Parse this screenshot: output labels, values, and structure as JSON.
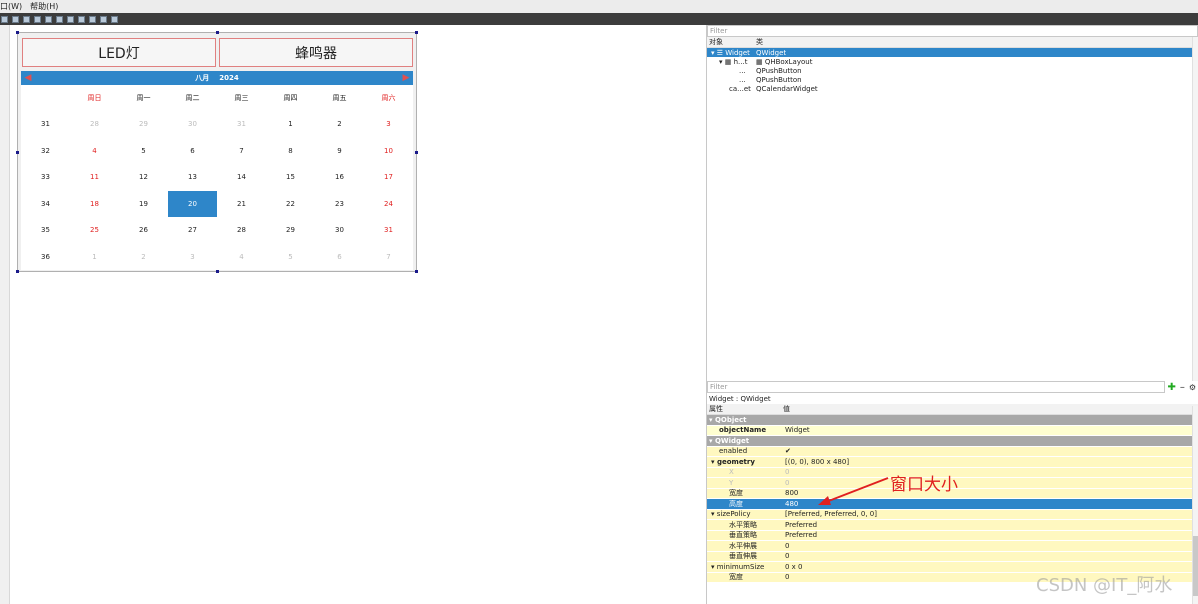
{
  "menu": {
    "items": [
      "口(W)",
      "帮助(H)"
    ]
  },
  "form": {
    "buttons": [
      "LED灯",
      "蜂鸣器"
    ],
    "calendar": {
      "month": "八月",
      "year": "2024",
      "weekday_headers": [
        "周日",
        "周一",
        "周二",
        "周三",
        "周四",
        "周五",
        "周六"
      ],
      "weeks": [
        {
          "num": "31",
          "days": [
            "28",
            "29",
            "30",
            "31",
            "1",
            "2",
            "3"
          ]
        },
        {
          "num": "32",
          "days": [
            "4",
            "5",
            "6",
            "7",
            "8",
            "9",
            "10"
          ]
        },
        {
          "num": "33",
          "days": [
            "11",
            "12",
            "13",
            "14",
            "15",
            "16",
            "17"
          ]
        },
        {
          "num": "34",
          "days": [
            "18",
            "19",
            "20",
            "21",
            "22",
            "23",
            "24"
          ]
        },
        {
          "num": "35",
          "days": [
            "25",
            "26",
            "27",
            "28",
            "29",
            "30",
            "31"
          ]
        },
        {
          "num": "36",
          "days": [
            "1",
            "2",
            "3",
            "4",
            "5",
            "6",
            "7"
          ]
        }
      ],
      "selected_day": "20"
    }
  },
  "object_inspector": {
    "filter_placeholder": "Filter",
    "col_object": "对象",
    "col_class": "类",
    "rows": [
      {
        "name": "Widget",
        "cls": "QWidget"
      },
      {
        "name": "h...t",
        "cls": "QHBoxLayout"
      },
      {
        "name": "...",
        "cls": "QPushButton"
      },
      {
        "name": "...",
        "cls": "QPushButton"
      },
      {
        "name": "ca...et",
        "cls": "QCalendarWidget"
      }
    ]
  },
  "property_editor": {
    "filter_placeholder": "Filter",
    "title": "Widget : QWidget",
    "col_property": "属性",
    "col_value": "值",
    "group_qobject": "QObject",
    "objectName_k": "objectName",
    "objectName_v": "Widget",
    "group_qwidget": "QWidget",
    "enabled_k": "enabled",
    "enabled_v": "✔",
    "geometry_k": "geometry",
    "geometry_v": "[(0, 0), 800 x 480]",
    "x_k": "X",
    "x_v": "0",
    "y_k": "Y",
    "y_v": "0",
    "width_k": "宽度",
    "width_v": "800",
    "height_k": "高度",
    "height_v": "480",
    "sizePolicy_k": "sizePolicy",
    "sizePolicy_v": "[Preferred, Preferred, 0, 0]",
    "hpolicy_k": "水平策略",
    "hpolicy_v": "Preferred",
    "vpolicy_k": "垂直策略",
    "vpolicy_v": "Preferred",
    "hstretch_k": "水平伸展",
    "hstretch_v": "0",
    "vstretch_k": "垂直伸展",
    "vstretch_v": "0",
    "minSize_k": "minimumSize",
    "minSize_v": "0 x 0",
    "minWidth_k": "宽度",
    "minWidth_v": "0"
  },
  "annotation": "窗口大小",
  "watermark": "CSDN @IT_阿水",
  "colors": {
    "accent": "#2e86c9",
    "annotation": "#e02020",
    "property_bg": "#ffffd0"
  }
}
